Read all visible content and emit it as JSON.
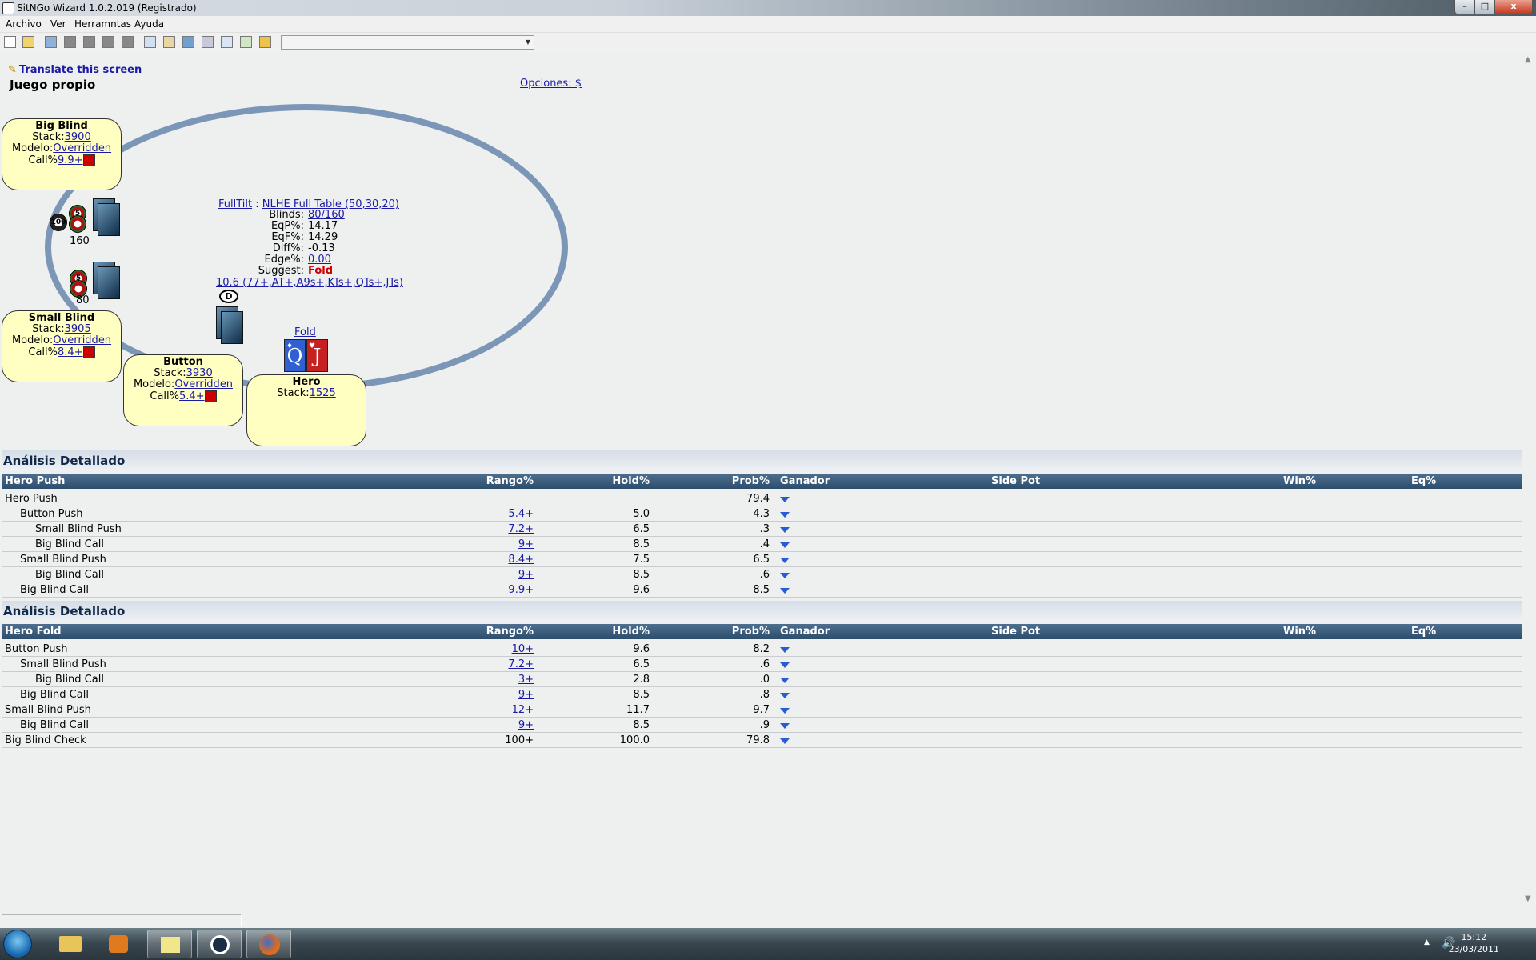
{
  "window": {
    "title": "SitNGo Wizard 1.0.2.019 (Registrado)",
    "min": "–",
    "max": "□",
    "close": "x"
  },
  "menu": [
    "Archivo",
    "Ver",
    "Herramntas",
    "Ayuda"
  ],
  "toolbar": {
    "combo_value": ""
  },
  "page": {
    "translate_link": "Translate this screen",
    "title": "Juego propio",
    "options_link": "Opciones: $"
  },
  "seats": {
    "big_blind": {
      "name": "Big Blind",
      "stack_label": "Stack:",
      "stack": "3900",
      "model_label": "Modelo:",
      "model": "Overridden",
      "call_label": "Call%",
      "call": "9.9+"
    },
    "small_blind": {
      "name": "Small Blind",
      "stack_label": "Stack:",
      "stack": "3905",
      "model_label": "Modelo:",
      "model": "Overridden",
      "call_label": "Call%",
      "call": "8.4+"
    },
    "button": {
      "name": "Button",
      "stack_label": "Stack:",
      "stack": "3930",
      "model_label": "Modelo:",
      "model": "Overridden",
      "call_label": "Call%",
      "call": "5.4+"
    },
    "hero": {
      "name": "Hero",
      "stack_label": "Stack:",
      "stack": "1525"
    }
  },
  "table": {
    "bb_bet": "160",
    "sb_bet": "80",
    "chip_100": "100",
    "chip_5": "5",
    "dealer": "D",
    "site": "FullTilt",
    "sep": ":",
    "game": "NLHE Full Table (50,30,20)",
    "blinds_label": "Blinds:",
    "blinds": "80/160",
    "eqp_label": "EqP%:",
    "eqp": "14.17",
    "eqf_label": "EqF%:",
    "eqf": "14.29",
    "diff_label": "Diff%:",
    "diff": "-0.13",
    "edge_label": "Edge%:",
    "edge": "0.00",
    "suggest_label": "Suggest:",
    "suggest": "Fold",
    "range": "10.6 (77+,AT+,A9s+,KTs+,QTs+,JTs)",
    "action_link": "Fold",
    "hero_cards": [
      {
        "rank": "Q",
        "suit": "♦",
        "color": "#2f5fd0"
      },
      {
        "rank": "J",
        "suit": "♥",
        "color": "#c62020"
      }
    ]
  },
  "analysis_push": {
    "section_title": "Análisis Detallado",
    "headers": [
      "Hero Push",
      "Rango%",
      "Hold%",
      "Prob%",
      "Ganador",
      "Side Pot",
      "Win%",
      "Eq%"
    ],
    "rows": [
      {
        "label": "Hero Push",
        "indent": 0,
        "range": "",
        "hold": "",
        "prob": "79.4"
      },
      {
        "label": "Button Push",
        "indent": 1,
        "range": "5.4+",
        "hold": "5.0",
        "prob": "4.3"
      },
      {
        "label": "Small Blind Push",
        "indent": 2,
        "range": "7.2+",
        "hold": "6.5",
        "prob": ".3"
      },
      {
        "label": "Big Blind Call",
        "indent": 2,
        "range": "9+",
        "hold": "8.5",
        "prob": ".4"
      },
      {
        "label": "Small Blind Push",
        "indent": 1,
        "range": "8.4+",
        "hold": "7.5",
        "prob": "6.5"
      },
      {
        "label": "Big Blind Call",
        "indent": 2,
        "range": "9+",
        "hold": "8.5",
        "prob": ".6"
      },
      {
        "label": "Big Blind Call",
        "indent": 1,
        "range": "9.9+",
        "hold": "9.6",
        "prob": "8.5"
      }
    ]
  },
  "analysis_fold": {
    "section_title": "Análisis Detallado",
    "headers": [
      "Hero Fold",
      "Rango%",
      "Hold%",
      "Prob%",
      "Ganador",
      "Side Pot",
      "Win%",
      "Eq%"
    ],
    "rows": [
      {
        "label": "Button Push",
        "indent": 0,
        "range": "10+",
        "hold": "9.6",
        "prob": "8.2"
      },
      {
        "label": "Small Blind Push",
        "indent": 1,
        "range": "7.2+",
        "hold": "6.5",
        "prob": ".6"
      },
      {
        "label": "Big Blind Call",
        "indent": 2,
        "range": "3+",
        "hold": "2.8",
        "prob": ".0"
      },
      {
        "label": "Big Blind Call",
        "indent": 1,
        "range": "9+",
        "hold": "8.5",
        "prob": ".8"
      },
      {
        "label": "Small Blind Push",
        "indent": 0,
        "range": "12+",
        "hold": "11.7",
        "prob": "9.7"
      },
      {
        "label": "Big Blind Call",
        "indent": 1,
        "range": "9+",
        "hold": "8.5",
        "prob": ".9"
      },
      {
        "label": "Big Blind Check",
        "indent": 0,
        "range": "100+",
        "range_plain": true,
        "hold": "100.0",
        "prob": "79.8"
      }
    ]
  },
  "taskbar": {
    "time": "15:12",
    "date": "23/03/2011"
  }
}
